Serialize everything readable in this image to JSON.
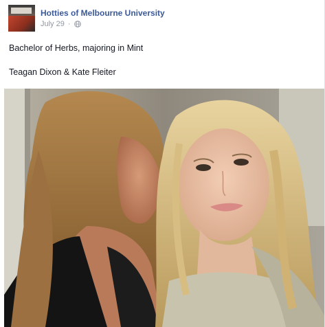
{
  "post": {
    "page_name": "Hotties of Melbourne University",
    "date": "July 29",
    "privacy_icon": "globe-icon",
    "caption_line1": "Bachelor of Herbs, majoring in Mint",
    "caption_line2": "Teagan Dixon & Kate Fleiter"
  },
  "colors": {
    "link": "#3b5998",
    "meta": "#9197a3",
    "text": "#141823"
  }
}
